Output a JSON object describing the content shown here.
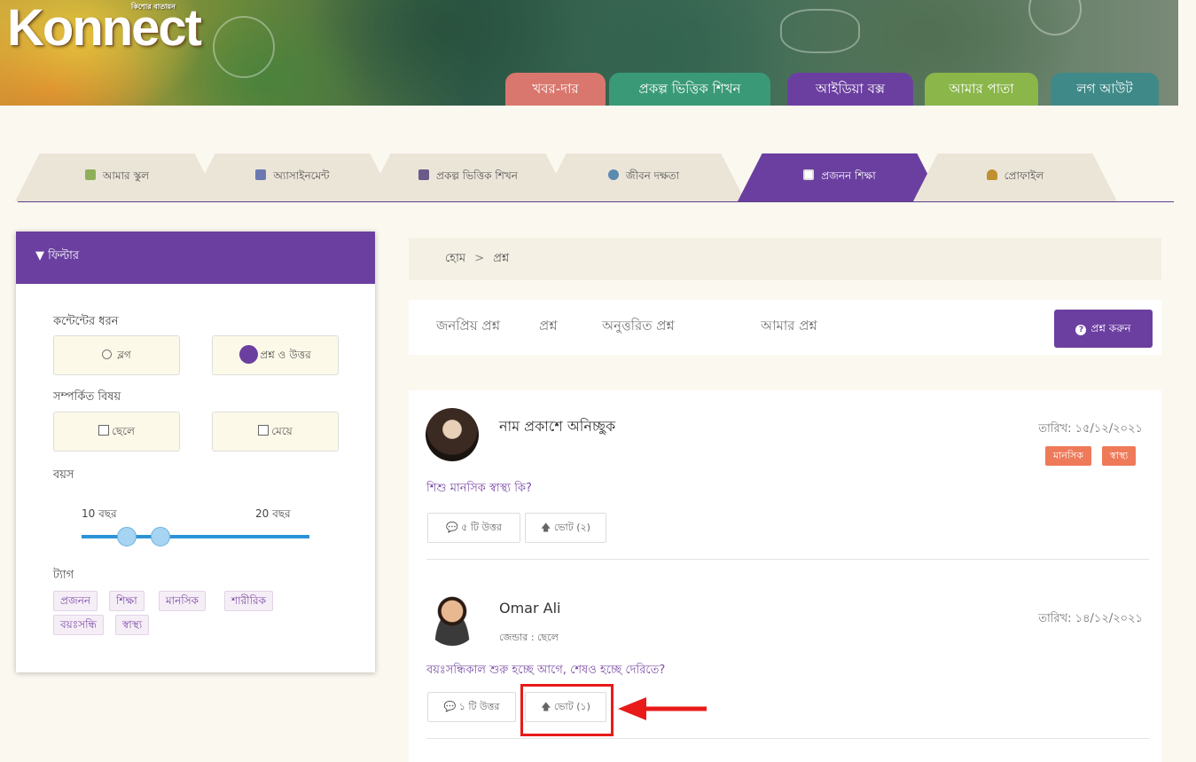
{
  "brand": {
    "logo_text": "Konnect",
    "logo_tagline": "কিশোর বাতায়ন"
  },
  "top_nav": [
    {
      "label": "খবর-দার",
      "color": "#d9776e"
    },
    {
      "label": "প্রকল্প ভিত্তিক শিখন",
      "color": "#3a9a78"
    },
    {
      "label": "আইডিয়া বক্স",
      "color": "#6b3fa0"
    },
    {
      "label": "আমার পাতা",
      "color": "#8ab64a"
    },
    {
      "label": "লগ আউট",
      "color": "#3f8a88"
    }
  ],
  "sub_nav": [
    {
      "label": "আমার স্কুল",
      "icon": "school-icon",
      "active": false
    },
    {
      "label": "অ্যাসাইনমেন্ট",
      "icon": "clipboard-icon",
      "active": false
    },
    {
      "label": "প্রকল্প ভিত্তিক শিখন",
      "icon": "calculator-icon",
      "active": false
    },
    {
      "label": "জীবন দক্ষতা",
      "icon": "people-icon",
      "active": false
    },
    {
      "label": "প্রজনন শিক্ষা",
      "icon": "notebook-icon",
      "active": true
    },
    {
      "label": "প্রোফাইল",
      "icon": "user-icon",
      "active": false
    }
  ],
  "filter": {
    "title": "ফিল্টার",
    "content_type_label": "কন্টেন্টের ধরন",
    "content_types": [
      {
        "label": "ব্লগ",
        "selected": false
      },
      {
        "label": "প্রশ্ন ও উত্তর",
        "selected": true
      }
    ],
    "related_label": "সম্পর্কিত বিষয়",
    "related": [
      {
        "label": "ছেলে",
        "checked": false
      },
      {
        "label": "মেয়ে",
        "checked": false
      }
    ],
    "age_label": "বয়স",
    "age_min": "10 বছর",
    "age_max": "20 বছর",
    "tags_label": "ট্যাগ",
    "tags": [
      "প্রজনন",
      "শিক্ষা",
      "মানসিক",
      "শারীরিক",
      "বয়ঃসন্ধি",
      "স্বাস্থ্য"
    ]
  },
  "breadcrumb": {
    "home": "হোম",
    "separator": ">",
    "current": "প্রশ্ন"
  },
  "question_tabs": [
    "জনপ্রিয় প্রশ্ন",
    "প্রশ্ন",
    "অনুত্তরিত প্রশ্ন",
    "আমার প্রশ্ন"
  ],
  "ask_button": "প্রশ্ন করুন",
  "posts": [
    {
      "name": "নাম প্রকাশে অনিচ্ছুক",
      "gender": "",
      "date": "তারিখ: ১৫/১২/২০২১",
      "question": "শিশু মানসিক স্বাস্থ্য কি?",
      "categories": [
        "মানসিক",
        "স্বাস্থ্য"
      ],
      "answers": "৫ টি উত্তর",
      "votes": "ভোট (২)"
    },
    {
      "name": "Omar Ali",
      "gender": "জেন্ডার : ছেলে",
      "date": "তারিখ: ১৪/১২/২০২১",
      "question": "বয়ঃসন্ধিকাল শুরু হচ্ছে আগে, শেষও হচ্ছে দেরিতে?",
      "categories": [],
      "answers": "১ টি উত্তর",
      "votes": "ভোট (১)"
    }
  ],
  "colors": {
    "primary": "#6b3fa0",
    "badge": "#ee7a5a",
    "slider": "#2d93d8",
    "annotation": "#e81a1a"
  }
}
